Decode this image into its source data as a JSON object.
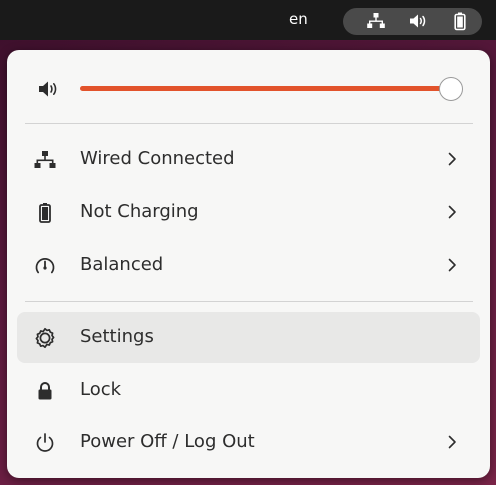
{
  "topbar": {
    "language": "en",
    "icons": [
      "network-wired-icon",
      "speaker-volume-icon",
      "battery-icon"
    ]
  },
  "menu": {
    "volume": {
      "icon": "speaker-volume-icon",
      "level": 1.0,
      "accent_color": "#e2532b"
    },
    "items": [
      {
        "label": "Wired Connected",
        "icon": "network-wired-icon",
        "submenu": true
      },
      {
        "label": "Not Charging",
        "icon": "battery-icon",
        "submenu": true
      },
      {
        "label": "Balanced",
        "icon": "power-profile-icon",
        "submenu": true
      },
      {
        "label": "Settings",
        "icon": "gear-icon",
        "submenu": false,
        "highlighted": true
      },
      {
        "label": "Lock",
        "icon": "lock-icon",
        "submenu": false
      },
      {
        "label": "Power Off / Log Out",
        "icon": "power-icon",
        "submenu": true
      }
    ]
  }
}
